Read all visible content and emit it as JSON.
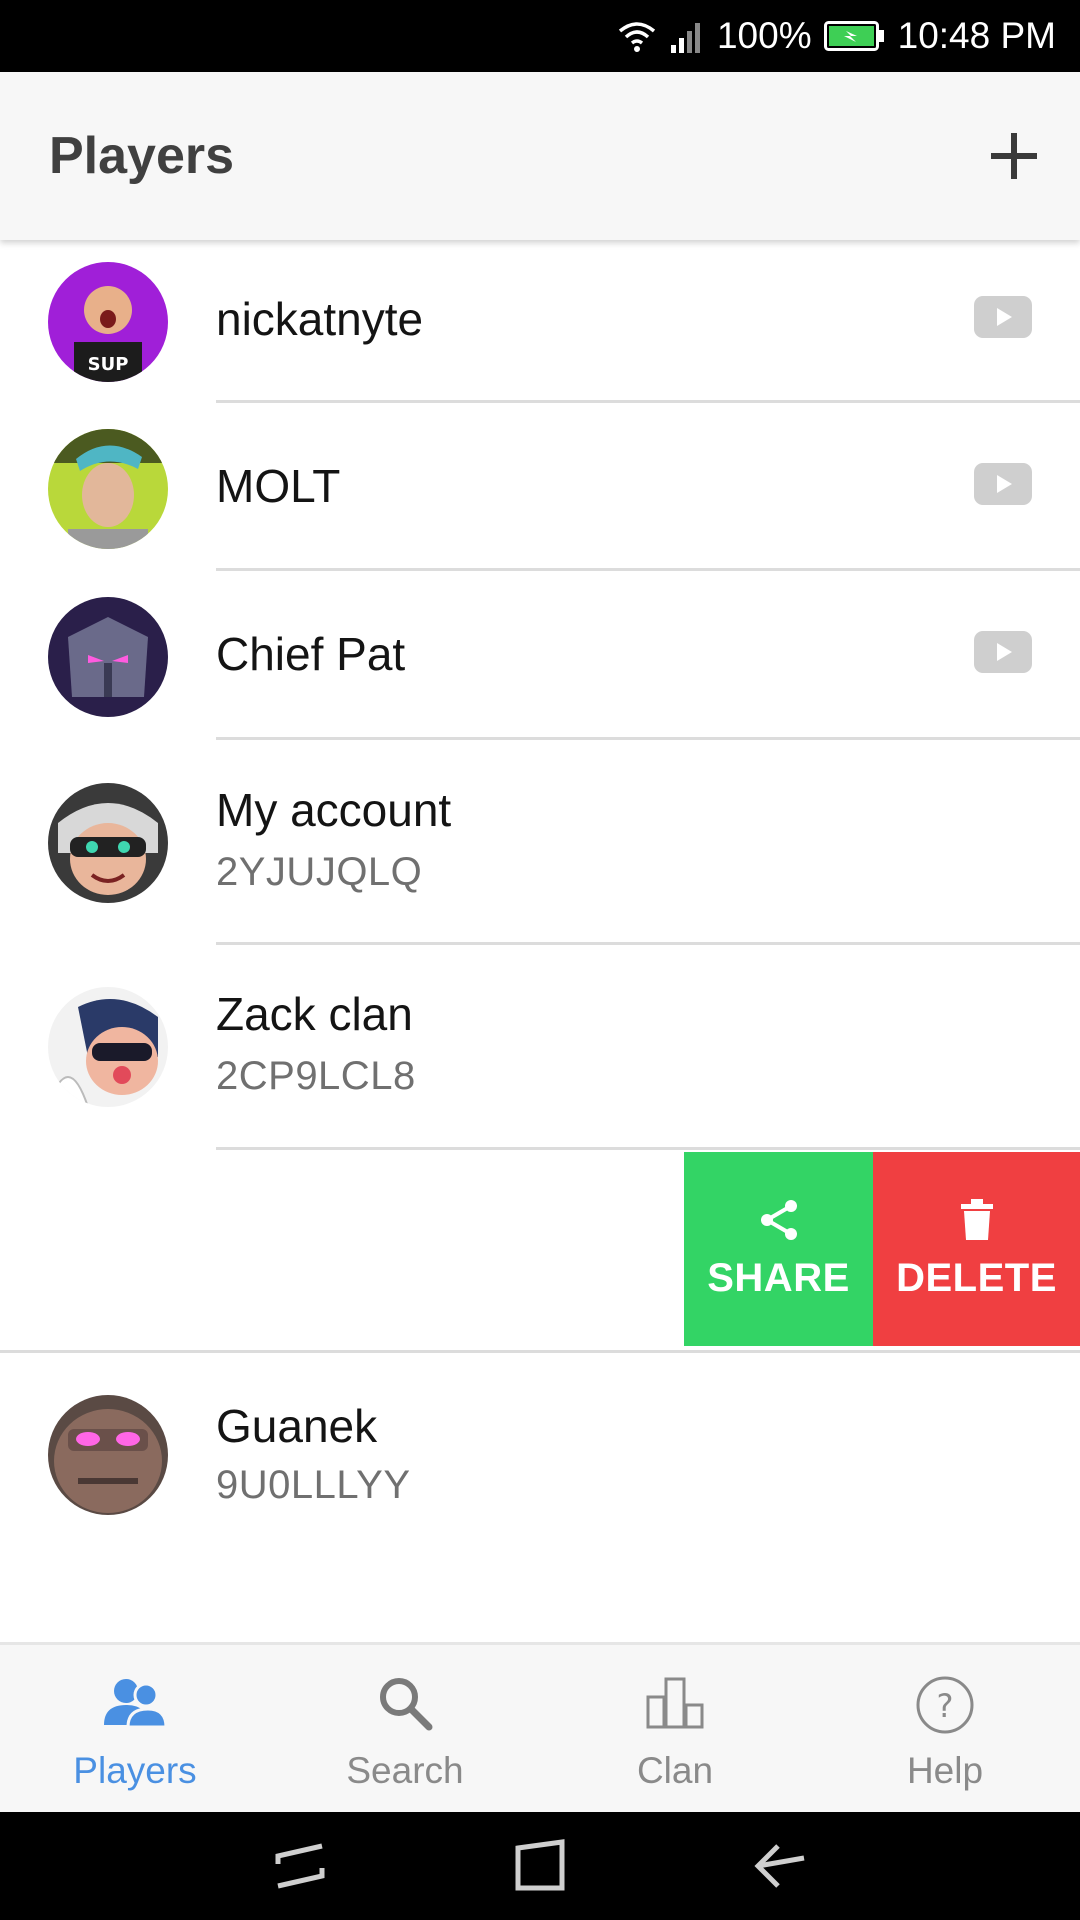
{
  "status_bar": {
    "battery": "100%",
    "time": "10:48 PM"
  },
  "app_bar": {
    "title": "Players",
    "add_icon": "plus-icon"
  },
  "players": [
    {
      "name": "nickatnyte",
      "tag": "",
      "youtube": true
    },
    {
      "name": "MOLT",
      "tag": "",
      "youtube": true
    },
    {
      "name": "Chief Pat",
      "tag": "",
      "youtube": true
    },
    {
      "name": "My account",
      "tag": "2YJUJQLQ",
      "youtube": false
    },
    {
      "name": "Zack clan",
      "tag": "2CP9LCL8",
      "youtube": false
    },
    {
      "name": "Guanek",
      "tag": "9U0LLLYY",
      "youtube": false
    }
  ],
  "swipe_actions": {
    "share": "SHARE",
    "delete": "DELETE"
  },
  "colors": {
    "share": "#33d465",
    "delete": "#f03f41",
    "active_tab": "#4a90e2"
  },
  "bottom_nav": {
    "items": [
      {
        "label": "Players",
        "icon": "players-icon",
        "active": true
      },
      {
        "label": "Search",
        "icon": "search-icon",
        "active": false
      },
      {
        "label": "Clan",
        "icon": "clan-icon",
        "active": false
      },
      {
        "label": "Help",
        "icon": "help-icon",
        "active": false
      }
    ]
  }
}
